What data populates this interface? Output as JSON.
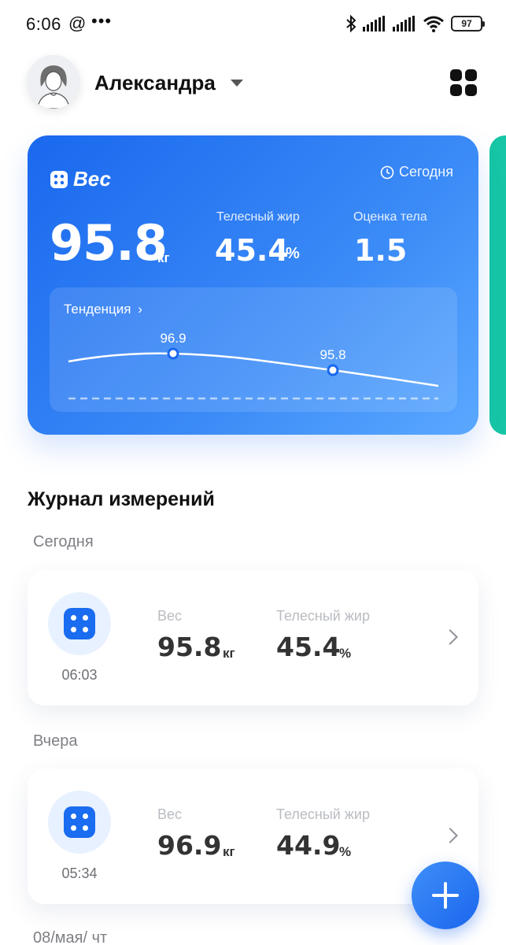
{
  "status_bar": {
    "time": "6:06",
    "at_sign": "@",
    "more": "•••",
    "battery": "97",
    "icons": [
      "bluetooth-icon",
      "signal-icon",
      "signal-icon",
      "wifi-icon",
      "battery-icon"
    ]
  },
  "header": {
    "user_name": "Александра",
    "apps_icon": "grid-apps-icon"
  },
  "weight_card": {
    "title": "Вес",
    "period": "Сегодня",
    "weight_value": "95.8",
    "weight_unit": "кг",
    "body_fat_label": "Телесный жир",
    "body_fat_value": "45.4",
    "body_fat_unit": "%",
    "body_score_label": "Оценка тела",
    "body_score_value": "1.5",
    "trend_title": "Тенденция",
    "trend_chevron": "›",
    "accent_color": "#1a68ee",
    "next_card_color": "#16c6a4"
  },
  "chart_data": {
    "type": "line",
    "title": "Тенденция",
    "series": [
      {
        "values": [
          96.9,
          95.8
        ],
        "point_labels": [
          "96.9",
          "95.8"
        ]
      }
    ]
  },
  "journal": {
    "title": "Журнал измерений",
    "groups": [
      {
        "label": "Сегодня",
        "records": [
          {
            "time": "06:03",
            "weight_label": "Вес",
            "weight_value": "95.8",
            "weight_unit": "кг",
            "fat_label": "Телесный жир",
            "fat_value": "45.4",
            "fat_unit": "%"
          }
        ]
      },
      {
        "label": "Вчера",
        "records": [
          {
            "time": "05:34",
            "weight_label": "Вес",
            "weight_value": "96.9",
            "weight_unit": "кг",
            "fat_label": "Телесный жир",
            "fat_value": "44.9",
            "fat_unit": "%"
          }
        ]
      },
      {
        "label": "08/мая/ чт",
        "records": []
      }
    ]
  },
  "fab": {
    "icon": "plus-icon"
  }
}
